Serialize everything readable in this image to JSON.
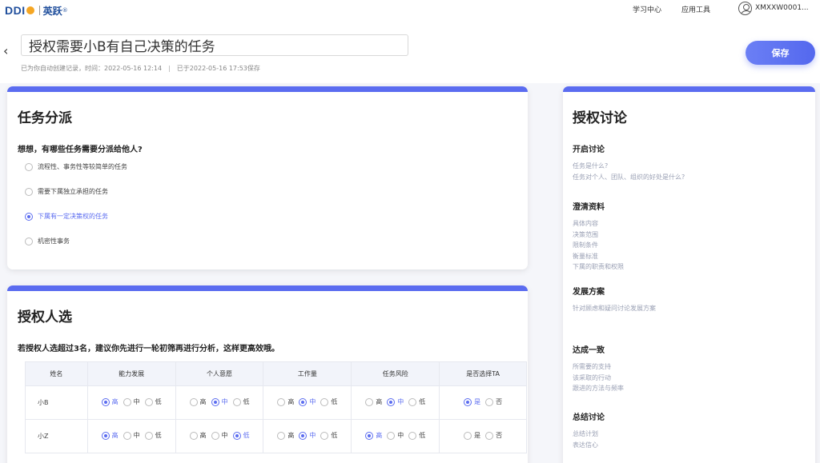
{
  "topbar": {
    "logo_ddi": "DDI",
    "logo_brand": "英跃",
    "logo_reg": "®",
    "nav_study": "学习中心",
    "nav_tools": "应用工具",
    "user_name": "XMXXW0001..."
  },
  "header": {
    "back_icon": "‹",
    "title_value": "授权需要小B有自己决策的任务",
    "meta_left": "已为你自动创建记录，时间：2022-05-16 12:14",
    "meta_sep": "|",
    "meta_right": "已于2022-05-16 17:53保存",
    "save_label": "保存"
  },
  "task_card": {
    "title": "任务分派",
    "question": "想想，有哪些任务需要分派给他人?",
    "options": [
      {
        "label": "流程性、事务性等较简单的任务",
        "selected": false
      },
      {
        "label": "需要下属独立承担的任务",
        "selected": false
      },
      {
        "label": "下属有一定决策权的任务",
        "selected": true
      },
      {
        "label": "机密性事务",
        "selected": false
      }
    ]
  },
  "candidate_card": {
    "title": "授权人选",
    "question": "若授权人选超过3名，建议你先进行一轮初筛再进行分析，这样更高效哦。",
    "columns": [
      "姓名",
      "能力发展",
      "个人意愿",
      "工作量",
      "任务风险",
      "是否选择TA"
    ],
    "level_labels": [
      "高",
      "中",
      "低"
    ],
    "yesno_labels": [
      "是",
      "否"
    ],
    "rows": [
      {
        "name": "小B",
        "ability": 0,
        "willingness": 1,
        "workload": 1,
        "risk": 1,
        "choose": 0
      },
      {
        "name": "小Z",
        "ability": 0,
        "willingness": 2,
        "workload": 1,
        "risk": 0,
        "choose": -1
      }
    ]
  },
  "discussion": {
    "title": "授权讨论",
    "sections": [
      {
        "title": "开启讨论",
        "items": [
          "任务是什么?",
          "任务对个人、团队、组织的好处是什么?"
        ]
      },
      {
        "title": "澄清资料",
        "items": [
          "具体内容",
          "决策范围",
          "限制条件",
          "衡量标准",
          "下属的职责和权限"
        ]
      },
      {
        "title": "发展方案",
        "items": [
          "针对顾虑和疑问讨论发展方案"
        ]
      },
      {
        "title": "达成一致",
        "items": [
          "所需要的支持",
          "该采取的行动",
          "跟进的方法与频率"
        ]
      },
      {
        "title": "总结讨论",
        "items": [
          "总结计划",
          "表达信心"
        ]
      }
    ]
  },
  "colors": {
    "accent": "#5b6cf0",
    "text": "#222222",
    "muted": "#9aa0b4"
  }
}
